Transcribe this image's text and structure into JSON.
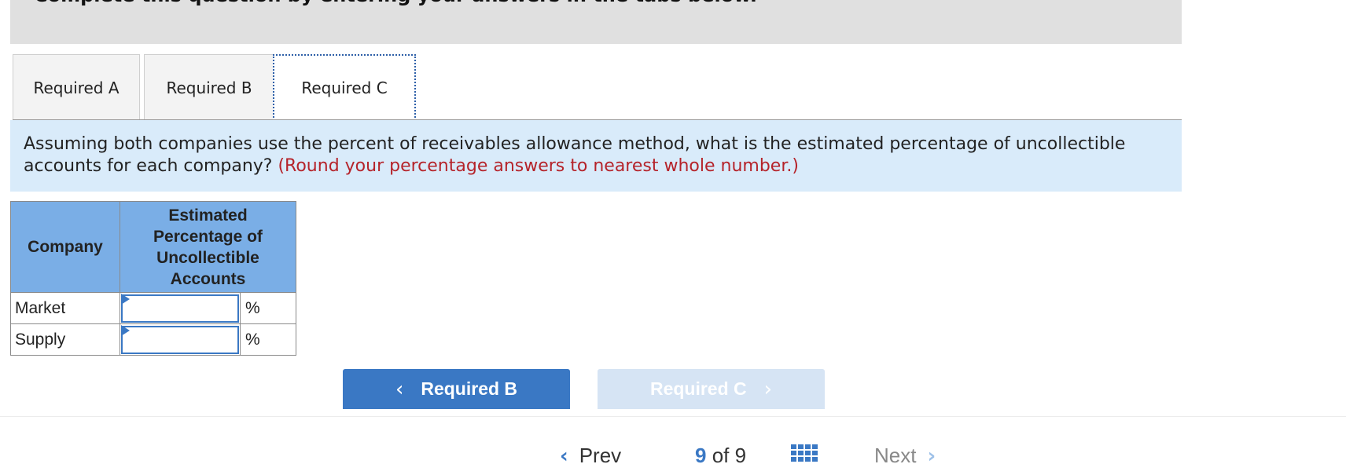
{
  "banner": {
    "text": "Complete this question by entering your answers in the tabs below."
  },
  "tabs": [
    {
      "label": "Required A",
      "active": false
    },
    {
      "label": "Required B",
      "active": false
    },
    {
      "label": "Required C",
      "active": true
    }
  ],
  "instruction": {
    "text": "Assuming both companies use the percent of receivables allowance method, what is the estimated percentage of uncollectible accounts for each company?",
    "note": "(Round your percentage answers to nearest whole number.)"
  },
  "table": {
    "headers": {
      "company": "Company",
      "estimate": "Estimated Percentage of Uncollectible Accounts"
    },
    "rows": [
      {
        "company": "Market",
        "value": "",
        "unit": "%"
      },
      {
        "company": "Supply",
        "value": "",
        "unit": "%"
      }
    ]
  },
  "nav_buttons": {
    "prev_label": "Required B",
    "next_label": "Required C"
  },
  "pager": {
    "prev_label": "Prev",
    "current": "9",
    "of_label": "of",
    "total": "9",
    "next_label": "Next"
  },
  "colors": {
    "accent": "#3a78c4",
    "header_bg": "#7aaee6",
    "instruction_bg": "#d9ebfa",
    "note_red": "#b5232a",
    "disabled_btn": "#d6e4f4"
  },
  "icons": {
    "prev_chevron": "chevron-left-icon",
    "next_chevron": "chevron-right-icon",
    "grid": "grid-icon"
  }
}
